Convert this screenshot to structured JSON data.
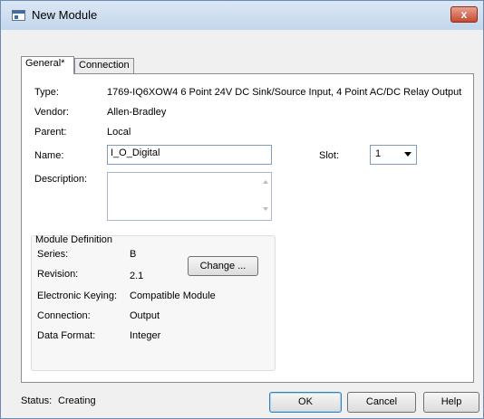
{
  "window": {
    "title": "New Module",
    "close_label": "x"
  },
  "tabs": [
    {
      "label": "General*"
    },
    {
      "label": "Connection"
    }
  ],
  "general": {
    "type_label": "Type:",
    "type_value": "1769-IQ6XOW4 6 Point 24V DC Sink/Source Input, 4 Point AC/DC Relay Output",
    "vendor_label": "Vendor:",
    "vendor_value": "Allen-Bradley",
    "parent_label": "Parent:",
    "parent_value": "Local",
    "name_label": "Name:",
    "name_value": "I_O_Digital",
    "slot_label": "Slot:",
    "slot_value": "1",
    "description_label": "Description:",
    "description_value": ""
  },
  "module_definition": {
    "title": "Module Definition",
    "series_label": "Series:",
    "series_value": "B",
    "revision_label": "Revision:",
    "revision_value": "2.1",
    "keying_label": "Electronic Keying:",
    "keying_value": "Compatible Module",
    "connection_label": "Connection:",
    "connection_value": "Output",
    "data_format_label": "Data Format:",
    "data_format_value": "Integer",
    "change_button": "Change ..."
  },
  "footer": {
    "status_label": "Status:",
    "status_value": "Creating",
    "ok_button": "OK",
    "cancel_button": "Cancel",
    "help_button": "Help"
  }
}
